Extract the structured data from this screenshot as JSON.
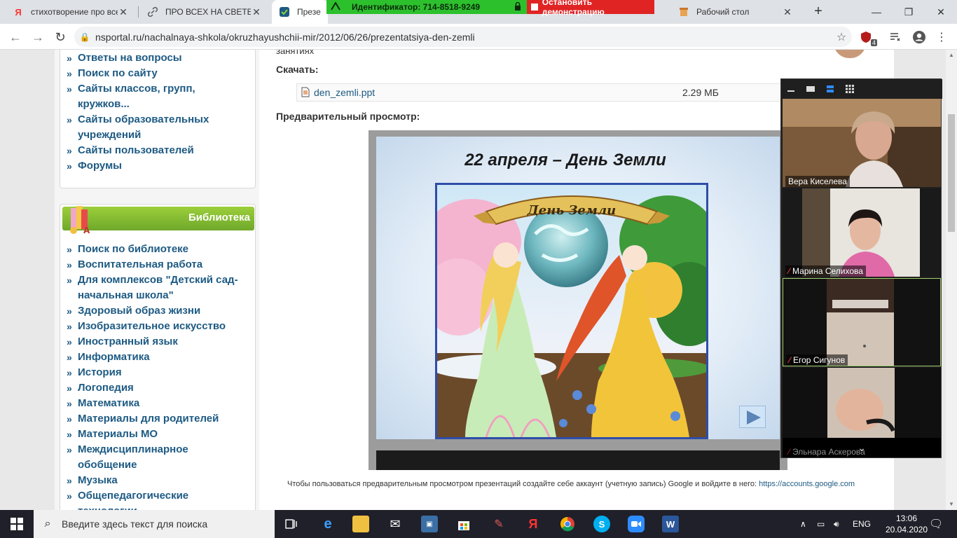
{
  "browser": {
    "tabs": [
      {
        "label": "стихотворение про все",
        "favicon": "Я",
        "favicon_color": "#ff3333",
        "active": false
      },
      {
        "label": "ПРО ВСЕХ НА СВЕТЕ Б",
        "favicon": "link-icon",
        "active": false
      },
      {
        "label": "Презен",
        "favicon": "check-icon",
        "active": true
      },
      {
        "label": "Рабочий стол",
        "favicon": "box-icon",
        "active": false
      }
    ],
    "url": "nsportal.ru/nachalnaya-shkola/okruzhayushchii-mir/2012/06/26/prezentatsiya-den-zemli",
    "ext_badge": "4"
  },
  "sharing": {
    "id_label": "Идентификатор: 714-8518-9249",
    "stop_label": "Остановить демонстрацию"
  },
  "sidebar": {
    "menu1": [
      "Ответы на вопросы",
      "Поиск по сайту",
      "Сайты классов, групп,",
      "кружков...",
      "Сайты образовательных",
      "учреждений",
      "Сайты пользователей",
      "Форумы"
    ],
    "library_title": "Библиотека",
    "menu2": [
      "Поиск по библиотеке",
      "Воспитательная работа",
      "Для комплексов \"Детский сад-",
      "начальная школа\"",
      "Здоровый образ жизни",
      "Изобразительное искусство",
      "Иностранный язык",
      "Информатика",
      "История",
      "Логопедия",
      "Математика",
      "Материалы для родителей",
      "Материалы МО",
      "Междисциплинарное",
      "обобщение",
      "Музыка",
      "Общепедагогические",
      "технологии"
    ]
  },
  "content": {
    "top_text": "занятиях",
    "download_label": "Скачать:",
    "file_name": "den_zemli.ppt",
    "file_size": "2.29 МБ",
    "preview_label": "Предварительный просмотр:",
    "slide_title": "22 апреля – День Земли",
    "banner_text": "День Земли",
    "notice_text": "Чтобы пользоваться предварительным просмотром презентаций создайте себе аккаунт (учетную запись) Google и войдите в него: ",
    "notice_link": "https://accounts.google.com"
  },
  "zoom": {
    "participants": [
      {
        "name": "Вера Киселева",
        "muted": false
      },
      {
        "name": "Марина Селихова",
        "muted": true
      },
      {
        "name": "Егор Сигунов",
        "muted": true
      },
      {
        "name": "Эльнара Аскерова",
        "muted": true
      }
    ]
  },
  "taskbar": {
    "search_placeholder": "Введите здесь текст для поиска",
    "lang": "ENG",
    "time": "13:06",
    "date": "20.04.2020"
  },
  "colors": {
    "link": "#1d5a83",
    "share_green": "#2dc02d",
    "share_red": "#e02424",
    "library_green": "#7cb82f"
  }
}
